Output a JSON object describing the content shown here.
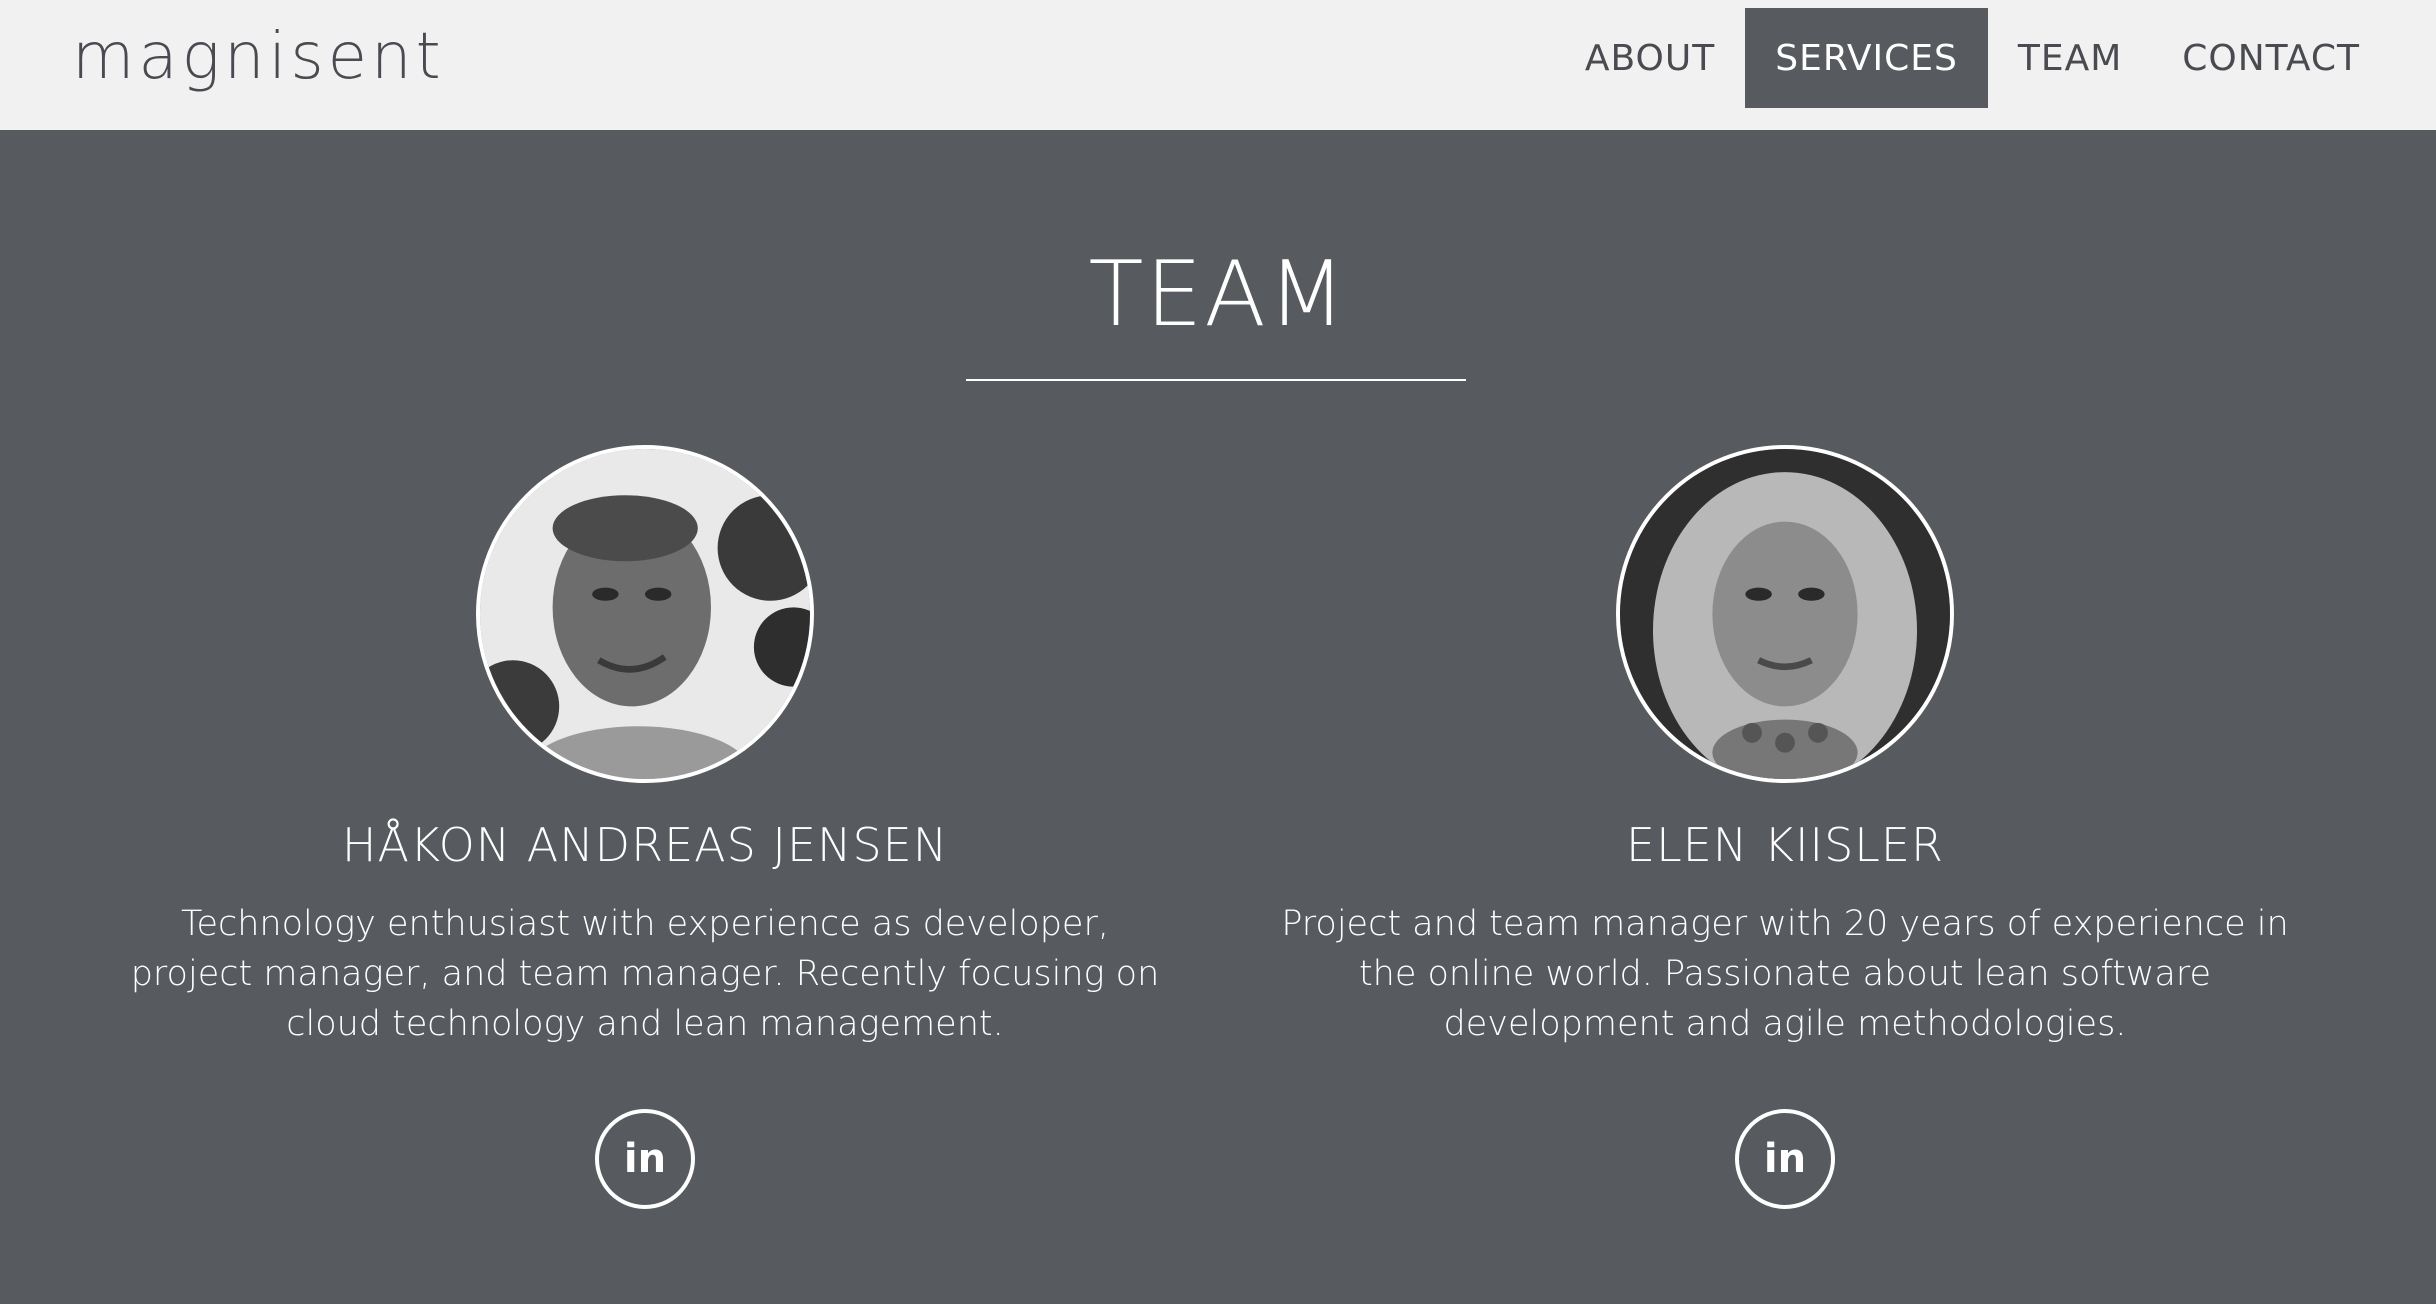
{
  "brand": {
    "logo_text": "magnisent"
  },
  "nav": {
    "items": [
      {
        "label": "ABOUT",
        "active": false
      },
      {
        "label": "SERVICES",
        "active": true
      },
      {
        "label": "TEAM",
        "active": false
      },
      {
        "label": "CONTACT",
        "active": false
      }
    ]
  },
  "team": {
    "title": "TEAM",
    "members": [
      {
        "name": "HÅKON ANDREAS JENSEN",
        "bio": "Technology enthusiast with experience as developer, project manager, and team manager. Recently focusing on cloud technology and lean management.",
        "social_icon": "linkedin-icon",
        "social_label": "in"
      },
      {
        "name": "ELEN KIISLER",
        "bio": "Project and team manager with 20 years of experience in the online world. Passionate about lean software development and agile methodologies.",
        "social_icon": "linkedin-icon",
        "social_label": "in"
      }
    ]
  },
  "colors": {
    "nav_background": "#f1f1f1",
    "section_background": "#575a5f",
    "text_light": "#ffffff",
    "text_dark": "#4a4b50"
  }
}
